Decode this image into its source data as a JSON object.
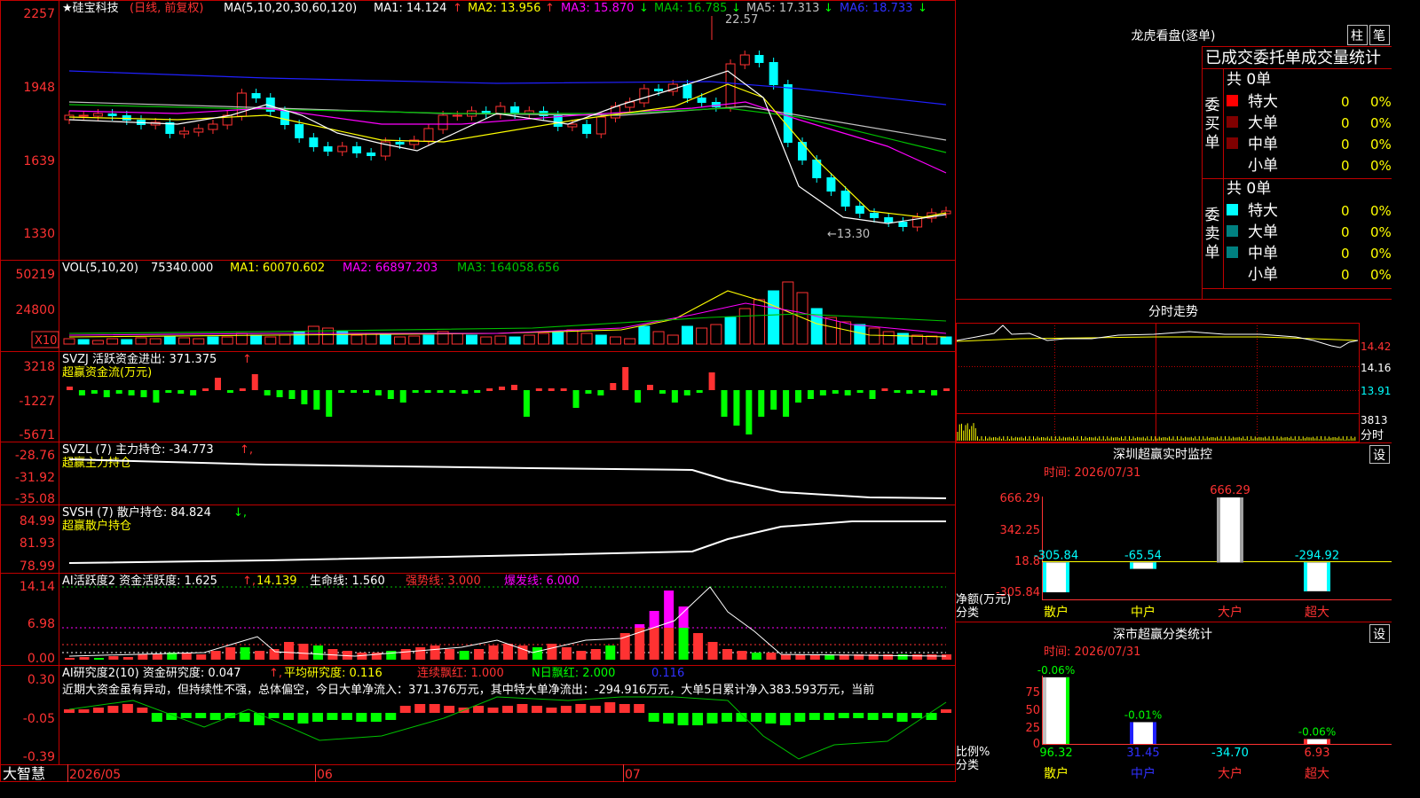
{
  "colors": {
    "up": "#ff3232",
    "down": "#00ffff",
    "frame": "#c00000",
    "ma1": "#ffffff",
    "ma2": "#ffff00",
    "ma3": "#ff00ff",
    "ma4": "#00c000",
    "ma5": "#c0c0c0",
    "ma6": "#0000ff",
    "buy_red": "#ff0000",
    "buy_dark": "#800000",
    "sell_cyan": "#00ffff",
    "sell_teal": "#008080"
  },
  "kline": {
    "stock": "★硅宝科技",
    "period": "(日线, 前复权)",
    "ma_param": "MA(5,10,20,30,60,120)",
    "ma1": "MA1: 14.124",
    "ma2": "MA2: 13.956",
    "ma3": "MA3: 15.870",
    "ma4": "MA4: 16.785",
    "ma5": "MA5: 17.313",
    "ma6": "MA6: 18.733",
    "ma1_arrow": "↑",
    "ma2_arrow": "↑",
    "ma3_arrow": "↓",
    "ma4_arrow": "↓",
    "ma5_arrow": "↓",
    "ma6_arrow": "↓",
    "high_label": "22.57",
    "low_label": "←13.30",
    "y_ticks": [
      "2257",
      "1948",
      "1639",
      "1330"
    ]
  },
  "vol": {
    "title": "VOL(5,10,20)",
    "value": "75340.000",
    "ma1": "MA1: 60070.602",
    "ma2": "MA2: 66897.203",
    "ma3": "MA3: 164058.656",
    "y_ticks": [
      "50219",
      "24800"
    ],
    "unit": "X10"
  },
  "svzj": {
    "title": "SVZJ  活跃资金进出: 371.375",
    "subtitle": "超赢资金流(万元)",
    "y_ticks": [
      "3218",
      "-1227",
      "-5671"
    ]
  },
  "svzl": {
    "title": "SVZL (7) 主力持仓: -34.773",
    "subtitle": "超赢主力持仓",
    "y_ticks": [
      "-28.76",
      "-31.92",
      "-35.08"
    ]
  },
  "svsh": {
    "title": "SVSH (7) 散户持仓: 84.824",
    "subtitle": "超赢散户持仓",
    "y_ticks": [
      "84.99",
      "81.93",
      "78.99"
    ]
  },
  "ai_active": {
    "title": "AI活跃度2 资金活跃度: 1.625",
    "v2": "14.139",
    "life": "生命线: 1.560",
    "strong": "强势线: 3.000",
    "burst": "爆发线: 6.000",
    "y_ticks": [
      "14.14",
      "6.98",
      "0.00"
    ]
  },
  "ai_research": {
    "title": "AI研究度2(10) 资金研究度: 0.047",
    "avg": "平均研究度: 0.116",
    "cont": "连续飘红: 1.000",
    "nday": "N日飘红: 2.000",
    "last": "0.116",
    "comment": "近期大资金虽有异动，但持续性不强，总体偏空，今日大单净流入：371.376万元，其中特大单净流出：-294.916万元，大单5日累计净入383.593万元，当前",
    "y_ticks": [
      "0.30",
      "-0.05",
      "-0.39"
    ]
  },
  "xaxis": {
    "brand": "大智慧",
    "labels": [
      "2026/05",
      "06",
      "07"
    ]
  },
  "dragon": {
    "title": "龙虎看盘(逐单)",
    "btn1": "柱",
    "btn2": "笔",
    "stat_title": "已成交委托单成交量统计",
    "buy_side": "委买单",
    "sell_side": "委卖单",
    "buy_total": "共 0单",
    "sell_total": "共 0单",
    "rows_buy": [
      {
        "name": "特大",
        "n": "0",
        "pct": "0%"
      },
      {
        "name": "大单",
        "n": "0",
        "pct": "0%"
      },
      {
        "name": "中单",
        "n": "0",
        "pct": "0%"
      },
      {
        "name": "小单",
        "n": "0",
        "pct": "0%"
      }
    ],
    "rows_sell": [
      {
        "name": "特大",
        "n": "0",
        "pct": "0%"
      },
      {
        "name": "大单",
        "n": "0",
        "pct": "0%"
      },
      {
        "name": "中单",
        "n": "0",
        "pct": "0%"
      },
      {
        "name": "小单",
        "n": "0",
        "pct": "0%"
      }
    ]
  },
  "intraday": {
    "title": "分时走势",
    "ticks": [
      "14.42",
      "14.16",
      "13.91",
      "3813"
    ],
    "vol_label": "分时"
  },
  "sz_monitor": {
    "title": "深圳超赢实时监控",
    "btn": "设",
    "date": "时间: 2026/07/31",
    "y_ticks": [
      "666.29",
      "342.25",
      "18.8",
      "-305.84"
    ],
    "ylabel": "净额(万元)",
    "xlabel": "分类",
    "cats": [
      "散户",
      "中户",
      "大户",
      "超大"
    ],
    "values": [
      -305.84,
      -65.54,
      666.29,
      -294.92
    ],
    "value_labels": [
      "-305.84",
      "-65.54",
      "666.29",
      "-294.92"
    ]
  },
  "sz_class": {
    "title": "深市超赢分类统计",
    "btn": "设",
    "date": "时间: 2026/07/31",
    "y_ticks": [
      "75",
      "50",
      "25",
      "0"
    ],
    "ylabel": "比例%",
    "xlabel": "分类",
    "cats": [
      "散户",
      "中户",
      "大户",
      "超大"
    ],
    "top_labels": [
      "-0.06%",
      "-0.01%",
      "",
      "-0.06%"
    ],
    "bottom_labels": [
      "96.32",
      "31.45",
      "-34.70",
      "6.93"
    ]
  }
}
